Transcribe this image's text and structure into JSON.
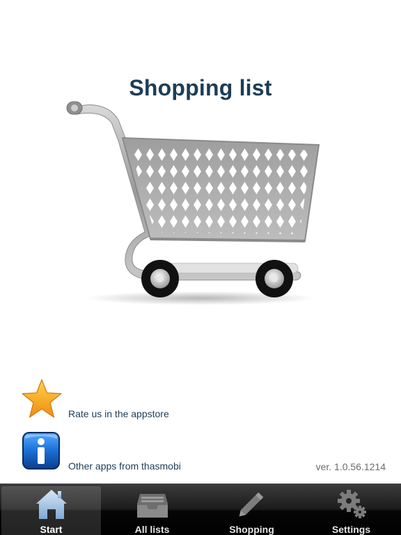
{
  "page": {
    "title": "Shopping list"
  },
  "actions": [
    {
      "label": "Rate us in the appstore",
      "icon": "star-icon"
    },
    {
      "label": "Other apps from thasmobi",
      "icon": "info-icon"
    }
  ],
  "version": "ver. 1.0.56.1214",
  "tabbar": {
    "tabs": [
      {
        "label": "Start",
        "icon": "home-icon",
        "active": true
      },
      {
        "label": "All lists",
        "icon": "inbox-tray-icon",
        "active": false
      },
      {
        "label": "Shopping",
        "icon": "pencil-icon",
        "active": false
      },
      {
        "label": "Settings",
        "icon": "gears-icon",
        "active": false
      }
    ]
  },
  "colors": {
    "title": "#1c3d56",
    "label": "#1c3d56",
    "version": "#6b6b6b",
    "tabbar": "#1c1c1c",
    "star": "#f7a81b",
    "info_badge": "#1a6fd6"
  }
}
